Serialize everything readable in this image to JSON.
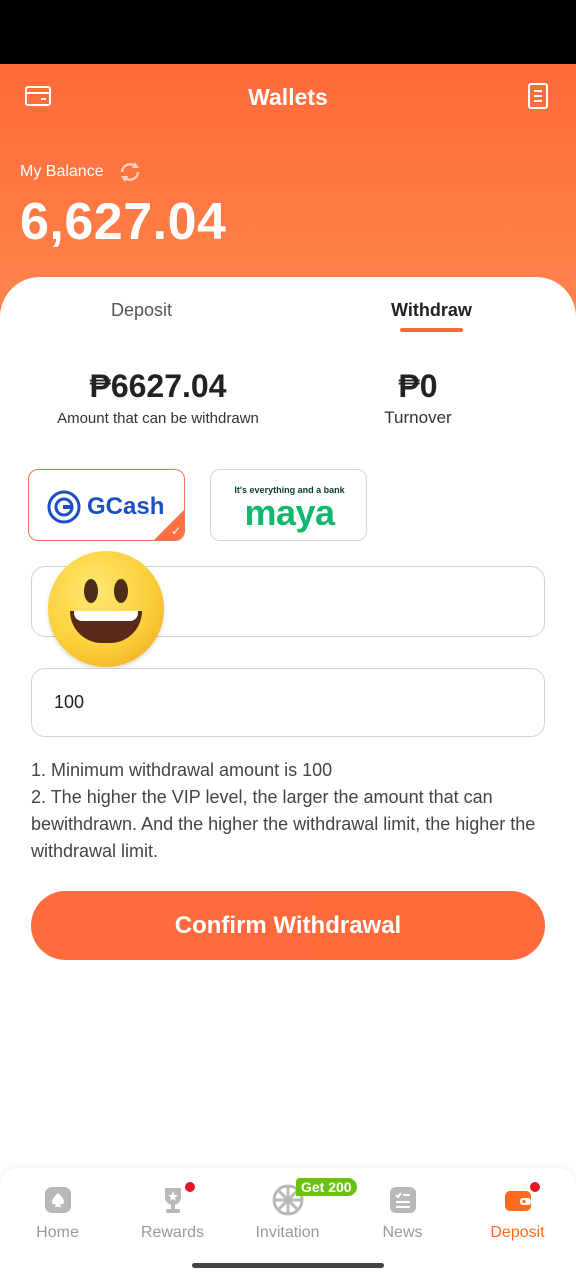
{
  "header": {
    "title": "Wallets",
    "balance_label": "My Balance",
    "balance_value": "6,627.04"
  },
  "tabs": [
    {
      "label": "Deposit",
      "active": false
    },
    {
      "label": "Withdraw",
      "active": true
    }
  ],
  "stats": {
    "withdrawable_value": "₱6627.04",
    "withdrawable_label": "Amount that can be withdrawn",
    "turnover_value": "₱0",
    "turnover_label": "Turnover"
  },
  "payment_methods": {
    "gcash_label": "GCash",
    "gcash_selected": true,
    "maya_tagline": "It's everything and a bank",
    "maya_label": "maya"
  },
  "form": {
    "account_value": "",
    "amount_value": "100"
  },
  "notes": {
    "line1": "1. Minimum withdrawal amount is 100",
    "line2": "2. The higher the VIP level, the larger the amount that can bewithdrawn. And the higher the withdrawal limit, the higher the withdrawal limit."
  },
  "confirm_label": "Confirm Withdrawal",
  "nav": {
    "home": "Home",
    "rewards": "Rewards",
    "invitation": "Invitation",
    "invitation_badge": "Get 200",
    "news": "News",
    "deposit": "Deposit"
  },
  "colors": {
    "accent": "#ff6a3a",
    "gcash_blue": "#1d4fc4",
    "maya_green": "#0fb86c",
    "badge_green": "#6ac20e",
    "notify_red": "#e8112a"
  }
}
